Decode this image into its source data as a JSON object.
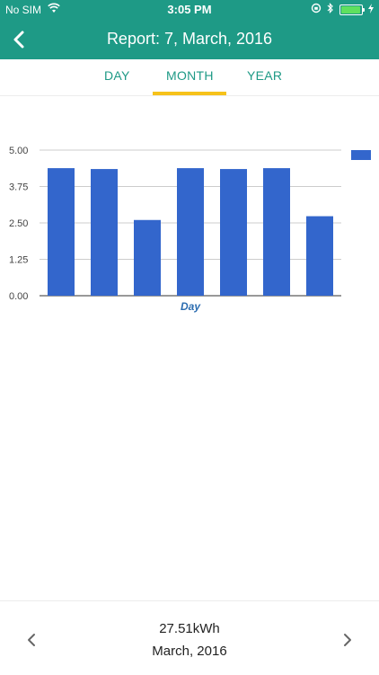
{
  "status": {
    "carrier": "No SIM",
    "time": "3:05 PM"
  },
  "header": {
    "title": "Report: 7, March, 2016"
  },
  "tabs": [
    "DAY",
    "MONTH",
    "YEAR"
  ],
  "active_tab": "MONTH",
  "chart_data": {
    "type": "bar",
    "xlabel": "Day",
    "ylabel": "",
    "ylim": [
      0,
      5
    ],
    "yticks": [
      "0.00",
      "1.25",
      "2.50",
      "3.75",
      "5.00"
    ],
    "values": [
      4.38,
      4.35,
      2.6,
      4.38,
      4.35,
      4.38,
      2.73
    ],
    "bar_color": "#3366cc",
    "grid": true,
    "legend": "right"
  },
  "footer": {
    "total": "27.51kWh",
    "period": "March, 2016"
  },
  "colors": {
    "accent": "#1e9a86",
    "indicator": "#f6c21a"
  }
}
